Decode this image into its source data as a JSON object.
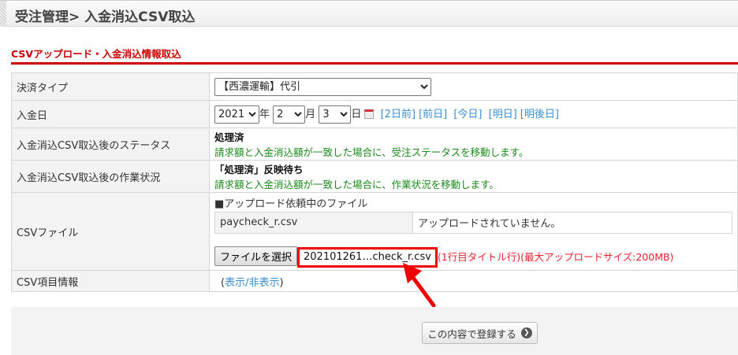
{
  "header": {
    "title": "受注管理> 入金消込CSV取込"
  },
  "section": {
    "title": "CSVアップロード・入金消込情報取込"
  },
  "rows": {
    "payment_type": {
      "label": "決済タイプ",
      "value": "【西濃運輸】代引"
    },
    "date": {
      "label": "入金日",
      "year": "2021",
      "year_unit": "年",
      "month": "2",
      "month_unit": "月",
      "day": "3",
      "day_unit": "日",
      "links": [
        "[2日前]",
        "[前日]",
        "[今日]",
        "[明日]",
        "[明後日]"
      ]
    },
    "status": {
      "label": "入金消込CSV取込後のステータス",
      "value": "処理済",
      "note": "請求額と入金消込額が一致した場合に、受注ステータスを移動します。"
    },
    "work": {
      "label": "入金消込CSV取込後の作業状況",
      "value": "「処理済」反映待ち",
      "note": "請求額と入金消込額が一致した場合に、作業状況を移動します。"
    },
    "csv": {
      "label": "CSVファイル",
      "pending_title": "■アップロード依頼中のファイル",
      "pending_file": "paycheck_r.csv",
      "pending_status": "アップロードされていません。",
      "choose_button": "ファイルを選択",
      "file_name": "202101261…check_r.csv",
      "note": "(1行目タイトル行)(最大アップロードサイズ:200MB)"
    },
    "csv_items": {
      "label": "CSV項目情報",
      "toggle_open": "(",
      "toggle": "表示/非表示",
      "toggle_close": ")"
    }
  },
  "submit": {
    "label": "この内容で登録する"
  },
  "colors": {
    "accent": "#cc0000",
    "link": "#3a8fd0",
    "green": "#1a8a1a"
  }
}
